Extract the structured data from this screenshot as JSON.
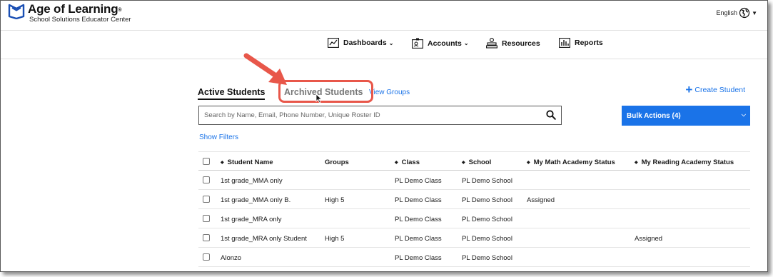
{
  "brand": {
    "title": "Age of Learning",
    "trademark": "®",
    "subtitle": "School Solutions Educator Center",
    "color": "#1a4fb4"
  },
  "language": {
    "label": "English"
  },
  "nav": {
    "dashboards": "Dashboards",
    "accounts": "Accounts",
    "resources": "Resources",
    "reports": "Reports"
  },
  "tabs": {
    "active": "Active Students",
    "archived": "Archived Students",
    "groups": "View Groups"
  },
  "create_student": "Create Student",
  "search": {
    "placeholder": "Search by Name, Email, Phone Number, Unique Roster ID",
    "value": ""
  },
  "bulk_actions": "Bulk Actions (4)",
  "show_filters": "Show Filters",
  "table": {
    "headers": {
      "name": "Student Name",
      "groups": "Groups",
      "class": "Class",
      "school": "School",
      "math": "My Math Academy Status",
      "reading": "My Reading Academy Status"
    },
    "rows": [
      {
        "name": "1st grade_MMA only",
        "groups": "",
        "class": "PL Demo Class",
        "school": "PL Demo School",
        "math": "",
        "reading": ""
      },
      {
        "name": "1st grade_MMA only B.",
        "groups": "High 5",
        "class": "PL Demo Class",
        "school": "PL Demo School",
        "math": "Assigned",
        "reading": ""
      },
      {
        "name": "1st grade_MRA only",
        "groups": "",
        "class": "PL Demo Class",
        "school": "PL Demo School",
        "math": "",
        "reading": ""
      },
      {
        "name": "1st grade_MRA only Student",
        "groups": "High 5",
        "class": "PL Demo Class",
        "school": "PL Demo School",
        "math": "",
        "reading": "Assigned"
      },
      {
        "name": "Alonzo",
        "groups": "",
        "class": "PL Demo Class",
        "school": "PL Demo School",
        "math": "",
        "reading": ""
      }
    ]
  },
  "colors": {
    "accent": "#1a73e8",
    "annotation": "#e8574a"
  }
}
